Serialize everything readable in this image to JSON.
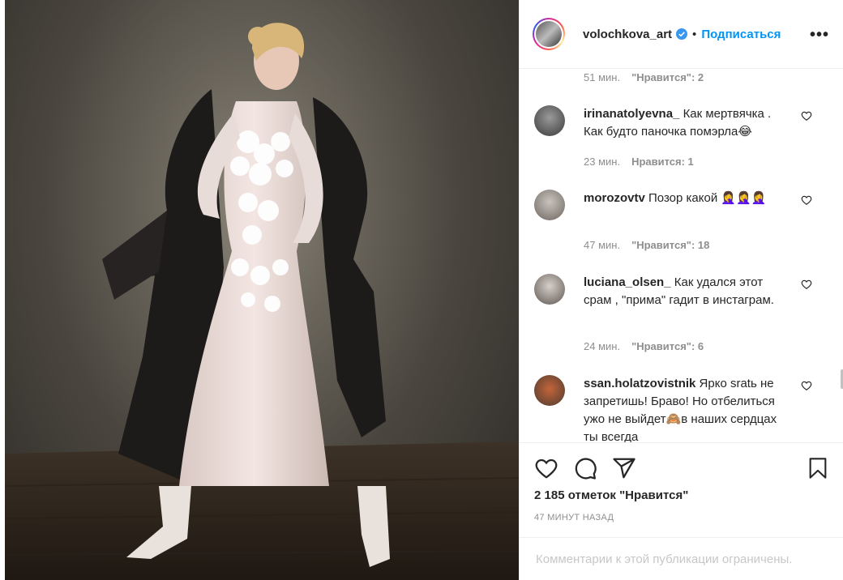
{
  "post": {
    "username": "volochkova_art",
    "follow_label": "Подписаться",
    "separator": "•",
    "more_label": "•••",
    "likes_text": "2 185 отметок \"Нравится\"",
    "time_text": "47 МИНУТ НАЗАД",
    "comments_limited": "Комментарии к этой публикации ограничены."
  },
  "top_meta": {
    "time": "51 мин.",
    "likes": "\"Нравится\": 2"
  },
  "comments": [
    {
      "username": "irinanatolyevna_",
      "text": "Как мертвячка . Как будто паночка помэрла😂",
      "time": "23 мин.",
      "likes": "Нравится: 1"
    },
    {
      "username": "morozovtv",
      "text": "Позор какой 🤦‍♀️🤦‍♀️🤦‍♀️",
      "time": "47 мин.",
      "likes": "\"Нравится\": 18"
    },
    {
      "username": "luciana_olsen_",
      "text": "Как удался этот срам , \"прима\" гадит в инстаграм.",
      "time": "24 мин.",
      "likes": "\"Нравится\": 6"
    },
    {
      "username": "ssan.holatzovistnik",
      "text": "Ярко sratь не запретишь! Браво! Но отбелиться ужо не выйдет🙈в наших сердцах ты всегда"
    }
  ],
  "colors": {
    "accent": "#0095f6",
    "text": "#262626",
    "muted": "#8e8e8e",
    "verified": "#3897f0"
  },
  "icons": [
    "heart-icon",
    "comment-icon",
    "share-icon",
    "bookmark-icon",
    "verified-icon",
    "more-icon"
  ]
}
